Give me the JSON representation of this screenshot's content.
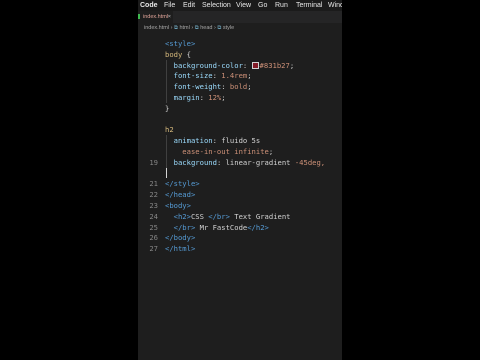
{
  "menubar": {
    "app": "Code",
    "items": [
      "File",
      "Edit",
      "Selection",
      "View",
      "Go",
      "Run",
      "Terminal",
      "Window"
    ]
  },
  "tab": {
    "filename": "index.html",
    "close_glyph": "×"
  },
  "breadcrumb": [
    "index.html",
    "html",
    "head",
    "style"
  ],
  "code_lines": [
    {
      "n": "",
      "tokens": [
        [
          "<style>",
          "k-tag"
        ]
      ]
    },
    {
      "n": "",
      "tokens": [
        [
          "body",
          "k-sel"
        ],
        [
          " {",
          "k-punc"
        ]
      ]
    },
    {
      "n": "",
      "tokens": [
        [
          "  background-color",
          "k-prop"
        ],
        [
          ": ",
          "k-punc"
        ],
        [
          "SWATCH",
          "swatch"
        ],
        [
          "#831b27",
          "k-val"
        ],
        [
          ";",
          "k-punc"
        ]
      ]
    },
    {
      "n": "",
      "tokens": [
        [
          "  font-size",
          "k-prop"
        ],
        [
          ": ",
          "k-punc"
        ],
        [
          "1.4rem",
          "k-val"
        ],
        [
          ";",
          "k-punc"
        ]
      ]
    },
    {
      "n": "",
      "tokens": [
        [
          "  font-weight",
          "k-prop"
        ],
        [
          ": ",
          "k-punc"
        ],
        [
          "bold",
          "k-val"
        ],
        [
          ";",
          "k-punc"
        ]
      ]
    },
    {
      "n": "",
      "tokens": [
        [
          "  margin",
          "k-prop"
        ],
        [
          ": ",
          "k-punc"
        ],
        [
          "12%",
          "k-val"
        ],
        [
          ";",
          "k-punc"
        ]
      ]
    },
    {
      "n": "",
      "tokens": [
        [
          "}",
          "k-punc"
        ]
      ]
    },
    {
      "n": "",
      "tokens": []
    },
    {
      "n": "",
      "tokens": [
        [
          "h2",
          "k-sel"
        ]
      ]
    },
    {
      "n": "",
      "tokens": [
        [
          "  animation",
          "k-prop"
        ],
        [
          ": ",
          "k-punc"
        ],
        [
          "fluido 5s",
          "k-plain"
        ]
      ]
    },
    {
      "n": "",
      "tokens": [
        [
          "    ease-in-out infinite",
          "k-val"
        ],
        [
          ";",
          "k-punc"
        ]
      ]
    },
    {
      "n": "19",
      "tokens": [
        [
          "  background",
          "k-prop"
        ],
        [
          ": ",
          "k-punc"
        ],
        [
          "linear-gradient",
          "k-plain"
        ],
        [
          " -45deg,",
          "k-val"
        ]
      ]
    },
    {
      "n": "",
      "tokens": [],
      "cursor": true
    },
    {
      "n": "21",
      "tokens": [
        [
          "</style>",
          "k-tag"
        ]
      ]
    },
    {
      "n": "22",
      "tokens": [
        [
          "</head>",
          "k-tag"
        ]
      ]
    },
    {
      "n": "23",
      "tokens": [
        [
          "<body>",
          "k-tag"
        ]
      ]
    },
    {
      "n": "24",
      "tokens": [
        [
          "  <h2>",
          "k-tag"
        ],
        [
          "CSS ",
          "k-plain"
        ],
        [
          "</br>",
          "k-tag"
        ],
        [
          " Text Gradient",
          "k-plain"
        ]
      ]
    },
    {
      "n": "25",
      "tokens": [
        [
          "  </br>",
          "k-tag"
        ],
        [
          " Mr FastCode",
          "k-plain"
        ],
        [
          "</h2>",
          "k-tag"
        ]
      ]
    },
    {
      "n": "26",
      "tokens": [
        [
          "</body>",
          "k-tag"
        ]
      ]
    },
    {
      "n": "27",
      "tokens": [
        [
          "</html>",
          "k-tag"
        ]
      ]
    }
  ],
  "colors": {
    "editor_bg": "#1e1e1e",
    "swatch": "#831b27",
    "selector": "#d7ba7d",
    "property": "#9cdcfe",
    "value": "#ce9178",
    "tag": "#569cd6"
  }
}
